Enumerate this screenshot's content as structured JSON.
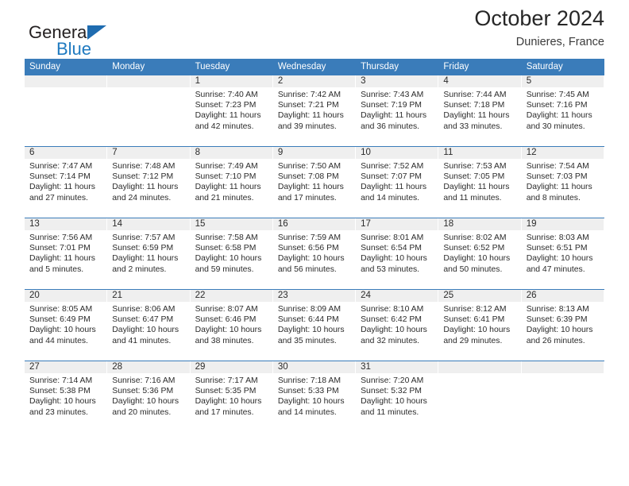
{
  "brand": {
    "name_top": "General",
    "name_bottom": "Blue",
    "top_color": "#231f20",
    "bottom_color": "#1f7ac0",
    "triangle_color": "#1f6cb0",
    "triangle_icon": "triangle-icon"
  },
  "header": {
    "title": "October 2024",
    "subtitle": "Dunieres, France"
  },
  "theme": {
    "header_bg": "#3a7cba",
    "header_text": "#ffffff",
    "daynum_strip_bg": "#efefef",
    "row_divider": "#3a7cba",
    "body_text": "#2b2b2b"
  },
  "weekdays": [
    "Sunday",
    "Monday",
    "Tuesday",
    "Wednesday",
    "Thursday",
    "Friday",
    "Saturday"
  ],
  "labels": {
    "sunrise_prefix": "Sunrise:",
    "sunset_prefix": "Sunset:",
    "daylight_prefix": "Daylight:"
  },
  "weeks": [
    [
      {
        "day": "",
        "empty": true
      },
      {
        "day": "",
        "empty": true
      },
      {
        "day": "1",
        "sunrise": "Sunrise: 7:40 AM",
        "sunset": "Sunset: 7:23 PM",
        "daylight_l1": "Daylight: 11 hours",
        "daylight_l2": "and 42 minutes."
      },
      {
        "day": "2",
        "sunrise": "Sunrise: 7:42 AM",
        "sunset": "Sunset: 7:21 PM",
        "daylight_l1": "Daylight: 11 hours",
        "daylight_l2": "and 39 minutes."
      },
      {
        "day": "3",
        "sunrise": "Sunrise: 7:43 AM",
        "sunset": "Sunset: 7:19 PM",
        "daylight_l1": "Daylight: 11 hours",
        "daylight_l2": "and 36 minutes."
      },
      {
        "day": "4",
        "sunrise": "Sunrise: 7:44 AM",
        "sunset": "Sunset: 7:18 PM",
        "daylight_l1": "Daylight: 11 hours",
        "daylight_l2": "and 33 minutes."
      },
      {
        "day": "5",
        "sunrise": "Sunrise: 7:45 AM",
        "sunset": "Sunset: 7:16 PM",
        "daylight_l1": "Daylight: 11 hours",
        "daylight_l2": "and 30 minutes."
      }
    ],
    [
      {
        "day": "6",
        "sunrise": "Sunrise: 7:47 AM",
        "sunset": "Sunset: 7:14 PM",
        "daylight_l1": "Daylight: 11 hours",
        "daylight_l2": "and 27 minutes."
      },
      {
        "day": "7",
        "sunrise": "Sunrise: 7:48 AM",
        "sunset": "Sunset: 7:12 PM",
        "daylight_l1": "Daylight: 11 hours",
        "daylight_l2": "and 24 minutes."
      },
      {
        "day": "8",
        "sunrise": "Sunrise: 7:49 AM",
        "sunset": "Sunset: 7:10 PM",
        "daylight_l1": "Daylight: 11 hours",
        "daylight_l2": "and 21 minutes."
      },
      {
        "day": "9",
        "sunrise": "Sunrise: 7:50 AM",
        "sunset": "Sunset: 7:08 PM",
        "daylight_l1": "Daylight: 11 hours",
        "daylight_l2": "and 17 minutes."
      },
      {
        "day": "10",
        "sunrise": "Sunrise: 7:52 AM",
        "sunset": "Sunset: 7:07 PM",
        "daylight_l1": "Daylight: 11 hours",
        "daylight_l2": "and 14 minutes."
      },
      {
        "day": "11",
        "sunrise": "Sunrise: 7:53 AM",
        "sunset": "Sunset: 7:05 PM",
        "daylight_l1": "Daylight: 11 hours",
        "daylight_l2": "and 11 minutes."
      },
      {
        "day": "12",
        "sunrise": "Sunrise: 7:54 AM",
        "sunset": "Sunset: 7:03 PM",
        "daylight_l1": "Daylight: 11 hours",
        "daylight_l2": "and 8 minutes."
      }
    ],
    [
      {
        "day": "13",
        "sunrise": "Sunrise: 7:56 AM",
        "sunset": "Sunset: 7:01 PM",
        "daylight_l1": "Daylight: 11 hours",
        "daylight_l2": "and 5 minutes."
      },
      {
        "day": "14",
        "sunrise": "Sunrise: 7:57 AM",
        "sunset": "Sunset: 6:59 PM",
        "daylight_l1": "Daylight: 11 hours",
        "daylight_l2": "and 2 minutes."
      },
      {
        "day": "15",
        "sunrise": "Sunrise: 7:58 AM",
        "sunset": "Sunset: 6:58 PM",
        "daylight_l1": "Daylight: 10 hours",
        "daylight_l2": "and 59 minutes."
      },
      {
        "day": "16",
        "sunrise": "Sunrise: 7:59 AM",
        "sunset": "Sunset: 6:56 PM",
        "daylight_l1": "Daylight: 10 hours",
        "daylight_l2": "and 56 minutes."
      },
      {
        "day": "17",
        "sunrise": "Sunrise: 8:01 AM",
        "sunset": "Sunset: 6:54 PM",
        "daylight_l1": "Daylight: 10 hours",
        "daylight_l2": "and 53 minutes."
      },
      {
        "day": "18",
        "sunrise": "Sunrise: 8:02 AM",
        "sunset": "Sunset: 6:52 PM",
        "daylight_l1": "Daylight: 10 hours",
        "daylight_l2": "and 50 minutes."
      },
      {
        "day": "19",
        "sunrise": "Sunrise: 8:03 AM",
        "sunset": "Sunset: 6:51 PM",
        "daylight_l1": "Daylight: 10 hours",
        "daylight_l2": "and 47 minutes."
      }
    ],
    [
      {
        "day": "20",
        "sunrise": "Sunrise: 8:05 AM",
        "sunset": "Sunset: 6:49 PM",
        "daylight_l1": "Daylight: 10 hours",
        "daylight_l2": "and 44 minutes."
      },
      {
        "day": "21",
        "sunrise": "Sunrise: 8:06 AM",
        "sunset": "Sunset: 6:47 PM",
        "daylight_l1": "Daylight: 10 hours",
        "daylight_l2": "and 41 minutes."
      },
      {
        "day": "22",
        "sunrise": "Sunrise: 8:07 AM",
        "sunset": "Sunset: 6:46 PM",
        "daylight_l1": "Daylight: 10 hours",
        "daylight_l2": "and 38 minutes."
      },
      {
        "day": "23",
        "sunrise": "Sunrise: 8:09 AM",
        "sunset": "Sunset: 6:44 PM",
        "daylight_l1": "Daylight: 10 hours",
        "daylight_l2": "and 35 minutes."
      },
      {
        "day": "24",
        "sunrise": "Sunrise: 8:10 AM",
        "sunset": "Sunset: 6:42 PM",
        "daylight_l1": "Daylight: 10 hours",
        "daylight_l2": "and 32 minutes."
      },
      {
        "day": "25",
        "sunrise": "Sunrise: 8:12 AM",
        "sunset": "Sunset: 6:41 PM",
        "daylight_l1": "Daylight: 10 hours",
        "daylight_l2": "and 29 minutes."
      },
      {
        "day": "26",
        "sunrise": "Sunrise: 8:13 AM",
        "sunset": "Sunset: 6:39 PM",
        "daylight_l1": "Daylight: 10 hours",
        "daylight_l2": "and 26 minutes."
      }
    ],
    [
      {
        "day": "27",
        "sunrise": "Sunrise: 7:14 AM",
        "sunset": "Sunset: 5:38 PM",
        "daylight_l1": "Daylight: 10 hours",
        "daylight_l2": "and 23 minutes."
      },
      {
        "day": "28",
        "sunrise": "Sunrise: 7:16 AM",
        "sunset": "Sunset: 5:36 PM",
        "daylight_l1": "Daylight: 10 hours",
        "daylight_l2": "and 20 minutes."
      },
      {
        "day": "29",
        "sunrise": "Sunrise: 7:17 AM",
        "sunset": "Sunset: 5:35 PM",
        "daylight_l1": "Daylight: 10 hours",
        "daylight_l2": "and 17 minutes."
      },
      {
        "day": "30",
        "sunrise": "Sunrise: 7:18 AM",
        "sunset": "Sunset: 5:33 PM",
        "daylight_l1": "Daylight: 10 hours",
        "daylight_l2": "and 14 minutes."
      },
      {
        "day": "31",
        "sunrise": "Sunrise: 7:20 AM",
        "sunset": "Sunset: 5:32 PM",
        "daylight_l1": "Daylight: 10 hours",
        "daylight_l2": "and 11 minutes."
      },
      {
        "day": "",
        "empty": true
      },
      {
        "day": "",
        "empty": true
      }
    ]
  ]
}
